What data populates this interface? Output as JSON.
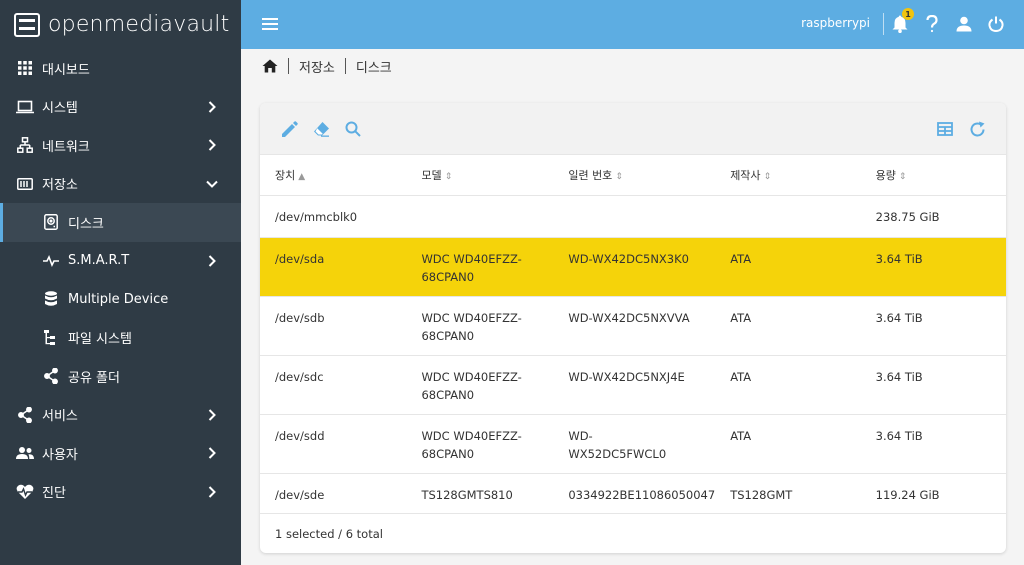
{
  "brand": {
    "name": "openmediavault"
  },
  "header": {
    "hostname": "raspberrypi",
    "notification_count": "1"
  },
  "sidebar": {
    "items": [
      {
        "label": "대시보드",
        "icon": "dashboard-icon"
      },
      {
        "label": "시스템",
        "icon": "laptop-icon"
      },
      {
        "label": "네트워크",
        "icon": "network-icon"
      },
      {
        "label": "저장소",
        "icon": "storage-icon"
      },
      {
        "label": "디스크",
        "icon": "disk-icon"
      },
      {
        "label": "S.M.A.R.T",
        "icon": "pulse-icon"
      },
      {
        "label": "Multiple Device",
        "icon": "database-icon"
      },
      {
        "label": "파일 시스템",
        "icon": "tree-icon"
      },
      {
        "label": "공유 폴더",
        "icon": "share-icon"
      },
      {
        "label": "서비스",
        "icon": "share-icon"
      },
      {
        "label": "사용자",
        "icon": "users-icon"
      },
      {
        "label": "진단",
        "icon": "heartbeat-icon"
      }
    ]
  },
  "breadcrumb": {
    "items": [
      "저장소",
      "디스크"
    ]
  },
  "table": {
    "columns": [
      "장치",
      "모델",
      "일련 번호",
      "제작사",
      "용량"
    ],
    "rows": [
      {
        "device": "/dev/mmcblk0",
        "model_1": "",
        "model_2": "",
        "serial_1": "",
        "serial_2": "",
        "vendor": "",
        "capacity": "238.75 GiB"
      },
      {
        "device": "/dev/sda",
        "model_1": "WDC WD40EFZZ-",
        "model_2": "68CPAN0",
        "serial_1": "WD-WX42DC5NX3K0",
        "serial_2": "",
        "vendor": "ATA",
        "capacity": "3.64 TiB"
      },
      {
        "device": "/dev/sdb",
        "model_1": "WDC WD40EFZZ-",
        "model_2": "68CPAN0",
        "serial_1": "WD-WX42DC5NXVVA",
        "serial_2": "",
        "vendor": "ATA",
        "capacity": "3.64 TiB"
      },
      {
        "device": "/dev/sdc",
        "model_1": "WDC WD40EFZZ-",
        "model_2": "68CPAN0",
        "serial_1": "WD-WX42DC5NXJ4E",
        "serial_2": "",
        "vendor": "ATA",
        "capacity": "3.64 TiB"
      },
      {
        "device": "/dev/sdd",
        "model_1": "WDC WD40EFZZ-",
        "model_2": "68CPAN0",
        "serial_1": "WD-",
        "serial_2": "WX52DC5FWCL0",
        "vendor": "ATA",
        "capacity": "3.64 TiB"
      },
      {
        "device": "/dev/sde",
        "model_1": "TS128GMTS810",
        "model_2": "",
        "serial_1": "0334922BE11086050047",
        "serial_2": "",
        "vendor": "TS128GMT",
        "capacity": "119.24 GiB"
      }
    ],
    "footer": "1 selected / 6 total"
  },
  "colors": {
    "accent": "#5dade2",
    "sidebar_bg": "#2f3b45",
    "selected_row": "#f5d30a"
  }
}
